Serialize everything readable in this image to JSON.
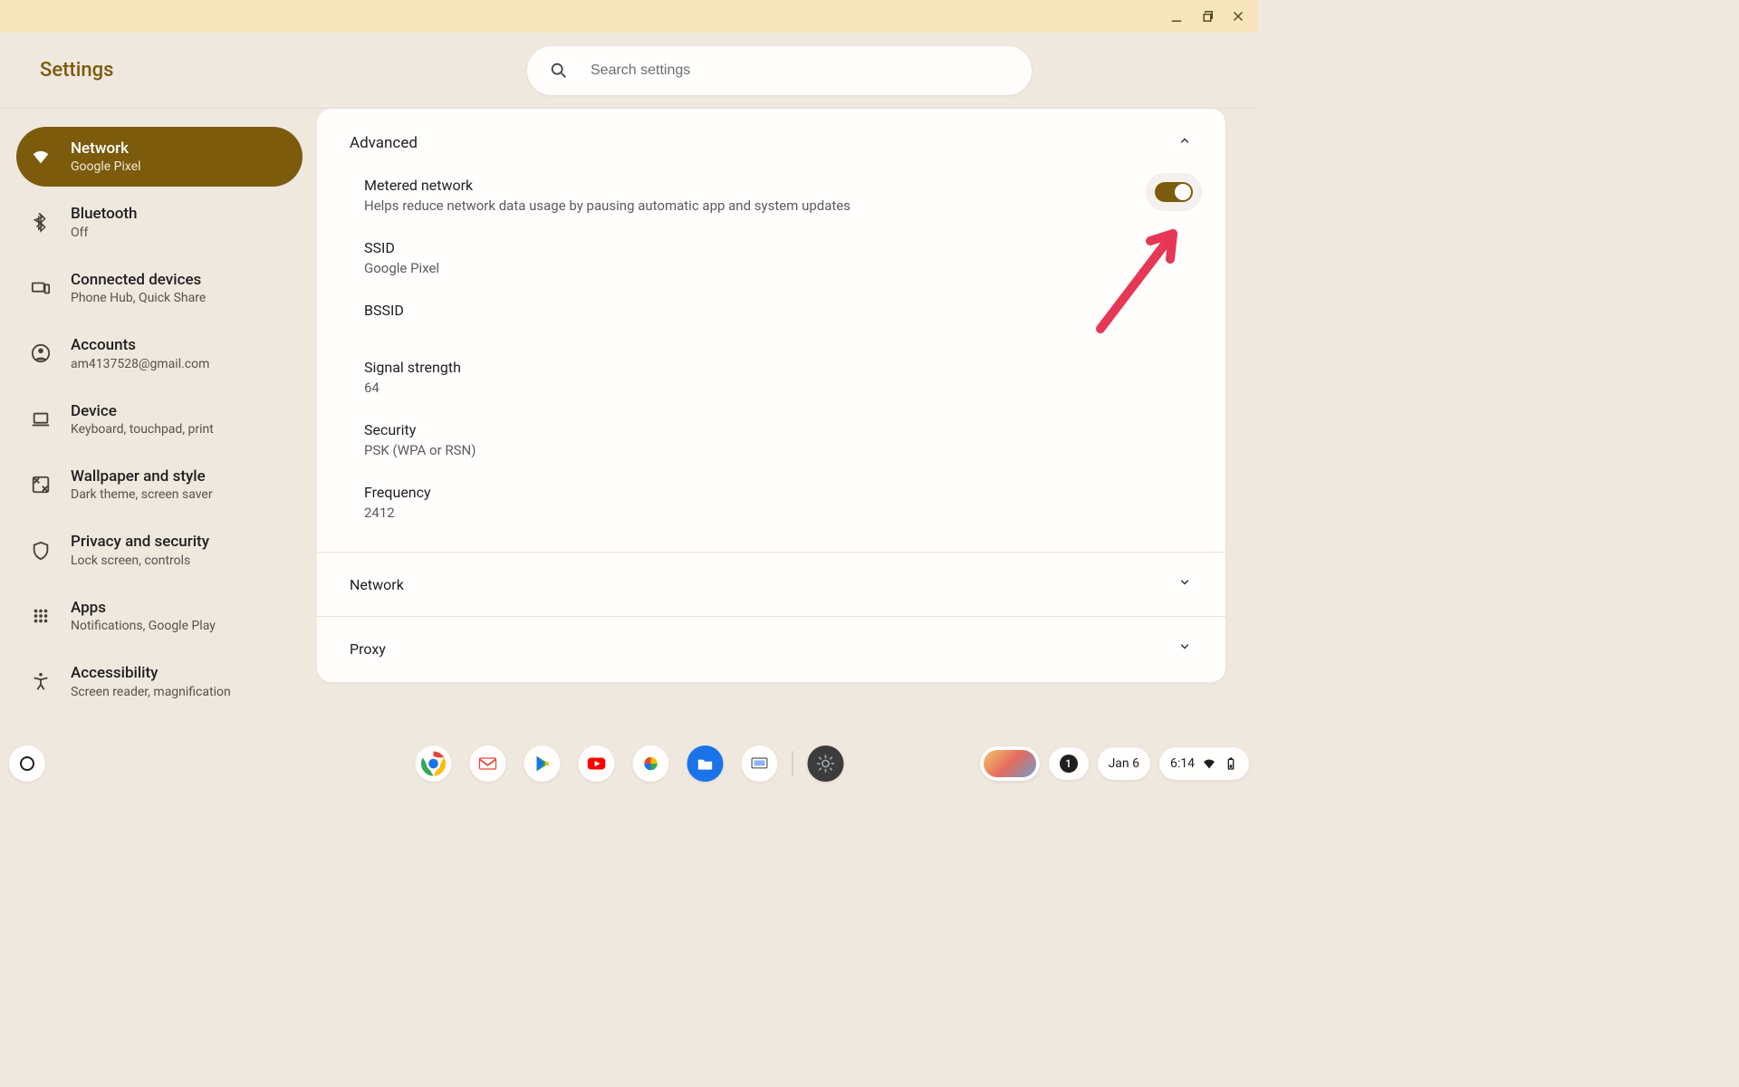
{
  "header": {
    "title": "Settings",
    "search_placeholder": "Search settings"
  },
  "sidebar": {
    "items": [
      {
        "title": "Network",
        "sub": "Google Pixel"
      },
      {
        "title": "Bluetooth",
        "sub": "Off"
      },
      {
        "title": "Connected devices",
        "sub": "Phone Hub, Quick Share"
      },
      {
        "title": "Accounts",
        "sub": "am4137528@gmail.com"
      },
      {
        "title": "Device",
        "sub": "Keyboard, touchpad, print"
      },
      {
        "title": "Wallpaper and style",
        "sub": "Dark theme, screen saver"
      },
      {
        "title": "Privacy and security",
        "sub": "Lock screen, controls"
      },
      {
        "title": "Apps",
        "sub": "Notifications, Google Play"
      },
      {
        "title": "Accessibility",
        "sub": "Screen reader, magnification"
      }
    ]
  },
  "main": {
    "advanced": {
      "header": "Advanced",
      "metered": {
        "label": "Metered network",
        "desc": "Helps reduce network data usage by pausing automatic app and system updates",
        "on": true
      },
      "ssid": {
        "label": "SSID",
        "value": "Google Pixel"
      },
      "bssid": {
        "label": "BSSID",
        "value": ""
      },
      "signal": {
        "label": "Signal strength",
        "value": "64"
      },
      "security": {
        "label": "Security",
        "value": "PSK (WPA or RSN)"
      },
      "frequency": {
        "label": "Frequency",
        "value": "2412"
      }
    },
    "network_section": "Network",
    "proxy_section": "Proxy"
  },
  "shelf": {
    "notif_count": "1",
    "date": "Jan 6",
    "time": "6:14"
  }
}
